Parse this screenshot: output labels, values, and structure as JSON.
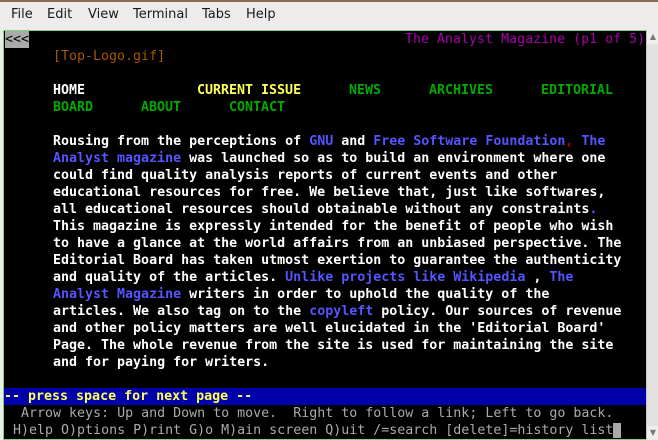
{
  "menubar": [
    "File",
    "Edit",
    "View",
    "Terminal",
    "Tabs",
    "Help"
  ],
  "terminal": {
    "back_marker": "<<<",
    "title": "The Analyst Magazine (p1 of 5)",
    "logo": "[Top-Logo.gif]",
    "nav": [
      {
        "label": "HOME",
        "col": 6,
        "row": 3,
        "color": "#ffffff"
      },
      {
        "label": "CURRENT ISSUE",
        "col": 24,
        "row": 3,
        "color": "#ffff55"
      },
      {
        "label": "NEWS",
        "col": 43,
        "row": 3,
        "color": "#00aa00"
      },
      {
        "label": "ARCHIVES",
        "col": 53,
        "row": 3,
        "color": "#00aa00"
      },
      {
        "label": "EDITORIAL",
        "col": 67,
        "row": 3,
        "color": "#00aa00"
      },
      {
        "label": "BOARD",
        "col": 6,
        "row": 4,
        "color": "#00aa00"
      },
      {
        "label": "ABOUT",
        "col": 17,
        "row": 4,
        "color": "#00aa00"
      },
      {
        "label": "CONTACT",
        "col": 28,
        "row": 4,
        "color": "#00aa00"
      }
    ],
    "body": [
      [
        {
          "t": "Rousing from the perceptions of "
        },
        {
          "t": "GNU",
          "k": "link"
        },
        {
          "t": " and "
        },
        {
          "t": "Free Software Foundation",
          "k": "link"
        },
        {
          "t": ",",
          "k": "red"
        },
        {
          "t": " "
        },
        {
          "t": "The",
          "k": "link"
        }
      ],
      [
        {
          "t": "Analyst magazine",
          "k": "link"
        },
        {
          "t": " was launched so as to build an environment where one"
        }
      ],
      [
        {
          "t": "could find quality analysis reports of current events and other"
        }
      ],
      [
        {
          "t": "educational resources for free. We believe that, just like softwares,"
        }
      ],
      [
        {
          "t": "all educational resources should obtainable without any constraints"
        },
        {
          "t": ".",
          "k": "link"
        }
      ],
      [
        {
          "t": "This magazine is expressly intended for the benefit of people who wish"
        }
      ],
      [
        {
          "t": "to have a glance at the world affairs from an unbiased perspective. The"
        }
      ],
      [
        {
          "t": "Editorial Board has taken utmost exertion to guarantee the authenticity"
        }
      ],
      [
        {
          "t": "and quality of the articles. "
        },
        {
          "t": "Unlike projects like Wikipedia",
          "k": "link"
        },
        {
          "t": " , "
        },
        {
          "t": "The",
          "k": "link"
        }
      ],
      [
        {
          "t": "Analyst Magazine",
          "k": "link"
        },
        {
          "t": " writers in order to uphold the quality of the"
        }
      ],
      [
        {
          "t": "articles. We also tag on to the "
        },
        {
          "t": "copyleft",
          "k": "link"
        },
        {
          "t": " policy. Our sources of revenue"
        }
      ],
      [
        {
          "t": "and other policy matters are well elucidated in the 'Editorial Board'"
        }
      ],
      [
        {
          "t": "Page. The whole revenue from the site is used for maintaining the site"
        }
      ],
      [
        {
          "t": "and for paying for writers."
        }
      ]
    ],
    "status": "-- press space for next page --",
    "help_line1": "  Arrow keys: Up and Down to move.  Right to follow a link; Left to go back.",
    "help_line2": " H)elp O)ptions P)rint G)o M)ain screen Q)uit /=search [delete]=history list",
    "colors": {
      "link": "#5555ff",
      "text": "#ffffff",
      "red": "#aa0000",
      "title": "#aa00aa",
      "logo": "#aa5500",
      "status_bg": "#0000aa",
      "status_fg": "#ffff55",
      "help": "#aaaaaa"
    }
  }
}
